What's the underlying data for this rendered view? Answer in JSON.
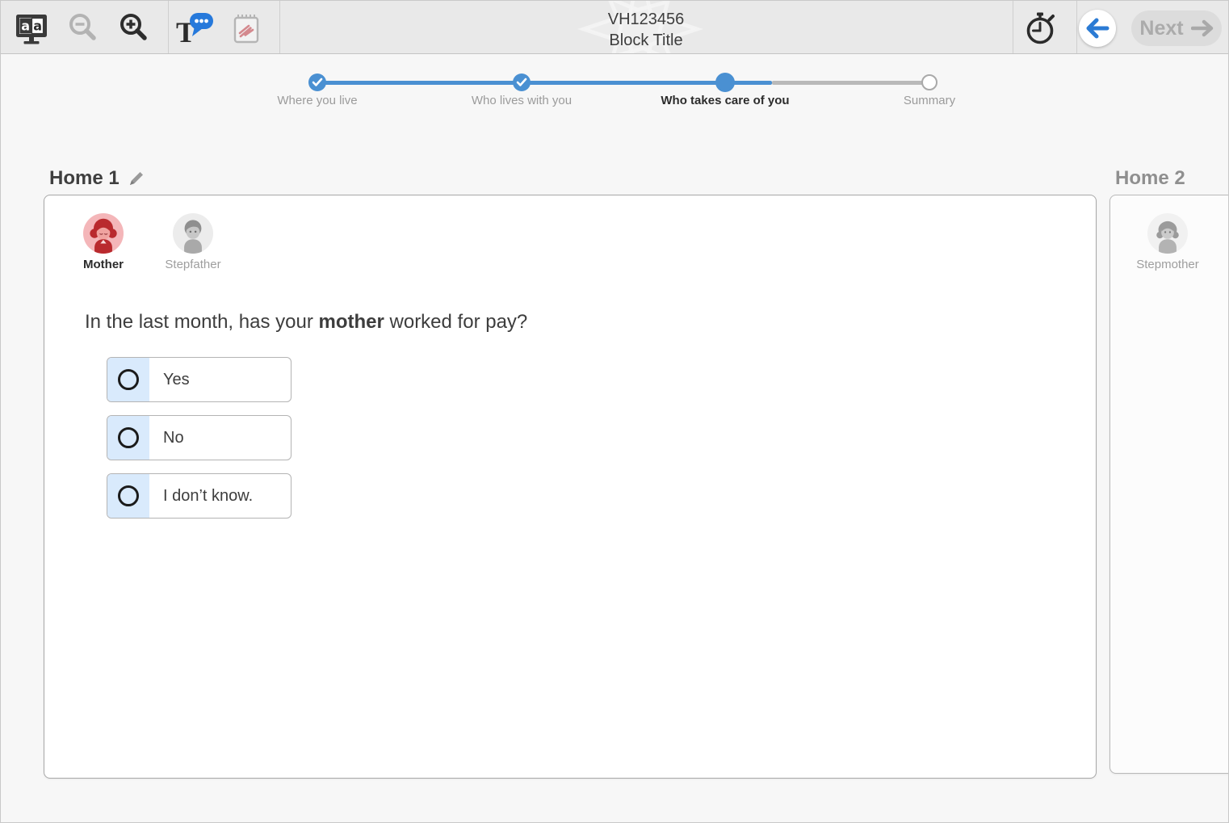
{
  "colors": {
    "accent_blue": "#4a90d2",
    "speech_bubble_blue": "#2679db",
    "mother_red": "#b92a2e",
    "mother_avatar_bg": "#f4b6b9",
    "option_radio_cell_bg": "#d9eafc",
    "disabled_gray": "#b5b5b5"
  },
  "toolbar": {
    "title_line1": "VH123456",
    "title_line2": "Block Title",
    "next_label": "Next",
    "icons": {
      "text_settings": "monitor-aa-icon",
      "zoom_out": "magnifier-minus-icon",
      "zoom_in": "magnifier-plus-icon",
      "text_to_speech": "T-speech-bubble-icon",
      "scratchwork": "notepad-scribble-icon",
      "timer": "stopwatch-icon",
      "back": "arrow-left-icon",
      "next": "arrow-right-icon"
    }
  },
  "stepper": {
    "steps": [
      {
        "label": "Where you live",
        "state": "completed"
      },
      {
        "label": "Who lives with you",
        "state": "completed"
      },
      {
        "label": "Who takes care of you",
        "state": "current"
      },
      {
        "label": "Summary",
        "state": "upcoming"
      }
    ]
  },
  "homes": [
    {
      "title": "Home 1",
      "editable": true,
      "people": [
        {
          "name": "Mother",
          "selected": true
        },
        {
          "name": "Stepfather",
          "selected": false
        }
      ]
    },
    {
      "title": "Home 2",
      "people": [
        {
          "name": "Stepmother",
          "selected": false
        }
      ]
    }
  ],
  "question": {
    "text_prefix": "In the last month, has your ",
    "text_bold": "mother",
    "text_suffix": " worked for pay?",
    "options": [
      "Yes",
      "No",
      "I don’t know."
    ]
  }
}
